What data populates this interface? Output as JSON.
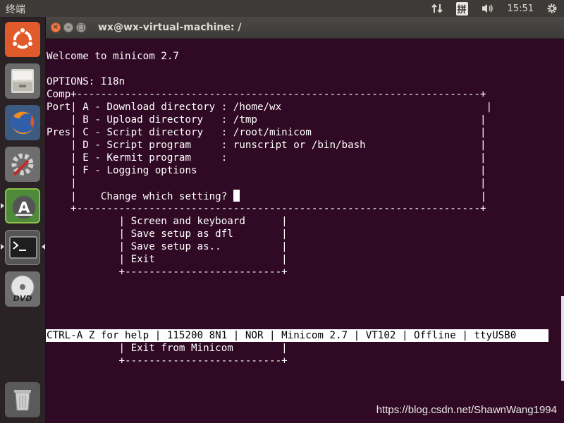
{
  "panel": {
    "app_name": "终端",
    "time": "15:51",
    "input_method": "拼"
  },
  "window": {
    "title": "wx@wx-virtual-machine: /"
  },
  "terminal": {
    "lines": [
      "",
      "Welcome to minicom 2.7",
      "",
      "OPTIONS: I18n",
      "Comp+-------------------------------------------------------------------+",
      "Port| A - Download directory : /home/wx                                  |",
      "    | B - Upload directory   : /tmp                                     |",
      "Pres| C - Script directory   : /root/minicom                            |",
      "    | D - Script program     : runscript or /bin/bash                   |",
      "    | E - Kermit program     :                                          |",
      "    | F - Logging options                                               |",
      "    |                                                                   |",
      "    |    Change which setting? ",
      "    +-------------------------------------------------------------------+",
      "            | Screen and keyboard      |",
      "            | Save setup as dfl        |",
      "            | Save setup as..          |",
      "            | Exit                     |",
      "            +--------------------------+",
      "",
      "",
      "",
      "",
      "",
      "            | Exit from Minicom        |",
      "            +--------------------------+"
    ],
    "prompt_tail": "|",
    "status_bar": "CTRL-A Z for help | 115200 8N1 | NOR | Minicom 2.7 | VT102 | Offline | ttyUSB0"
  },
  "launcher": {
    "items": [
      "ubuntu-dash",
      "files",
      "firefox",
      "system-settings",
      "software-updater",
      "terminal",
      "dvd",
      "trash"
    ]
  },
  "watermark": "https://blog.csdn.net/ShawnWang1994",
  "colors": {
    "terminal_bg": "#300a24",
    "panel_bg": "#3c3b37",
    "close_button": "#f07746"
  }
}
